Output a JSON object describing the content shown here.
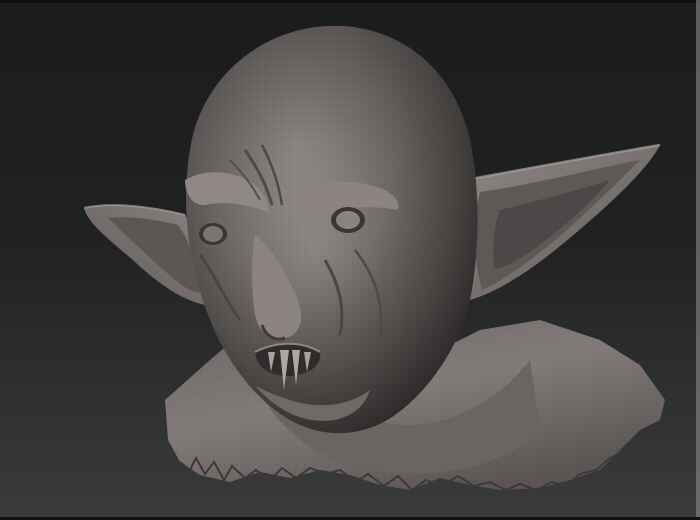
{
  "scene": {
    "subject": "",
    "colors": {
      "background_top": "#1b1c1d",
      "background_bottom": "#3a3b3d",
      "clay_light": "#9a9391",
      "clay_mid": "#756f6d",
      "clay_dark": "#4a4645",
      "clay_shadow": "#2f2c2b"
    }
  }
}
